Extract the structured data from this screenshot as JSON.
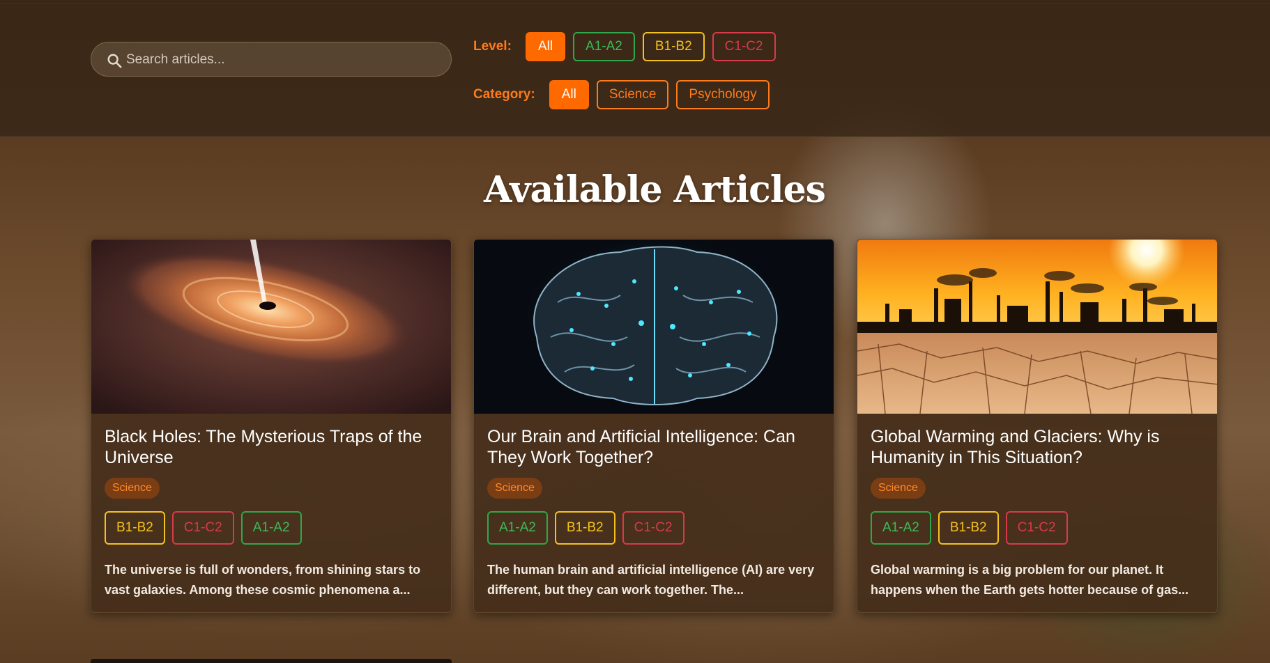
{
  "search": {
    "placeholder": "Search articles..."
  },
  "filters": {
    "level": {
      "label": "Level:",
      "options": [
        "All",
        "A1-A2",
        "B1-B2",
        "C1-C2"
      ]
    },
    "category": {
      "label": "Category:",
      "options": [
        "All",
        "Science",
        "Psychology"
      ]
    }
  },
  "page_title": "Available Articles",
  "articles": [
    {
      "title": "Black Holes: The Mysterious Traps of the Universe",
      "category": "Science",
      "levels": [
        "B1-B2",
        "C1-C2",
        "A1-A2"
      ],
      "excerpt": "The universe is full of wonders, from shining stars to vast galaxies. Among these cosmic phenomena a..."
    },
    {
      "title": "Our Brain and Artificial Intelligence: Can They Work Together?",
      "category": "Science",
      "levels": [
        "A1-A2",
        "B1-B2",
        "C1-C2"
      ],
      "excerpt": "The human brain and artificial intelligence (AI) are very different, but they can work together. The..."
    },
    {
      "title": "Global Warming and Glaciers: Why is Humanity in This Situation?",
      "category": "Science",
      "levels": [
        "A1-A2",
        "B1-B2",
        "C1-C2"
      ],
      "excerpt": "Global warming is a big problem for our planet. It happens when the Earth gets hotter because of gas..."
    }
  ],
  "colors": {
    "accent": "#ff6a00",
    "level_a": "#3dbb5a",
    "level_b": "#f4c21e",
    "level_c": "#d83a4a"
  }
}
